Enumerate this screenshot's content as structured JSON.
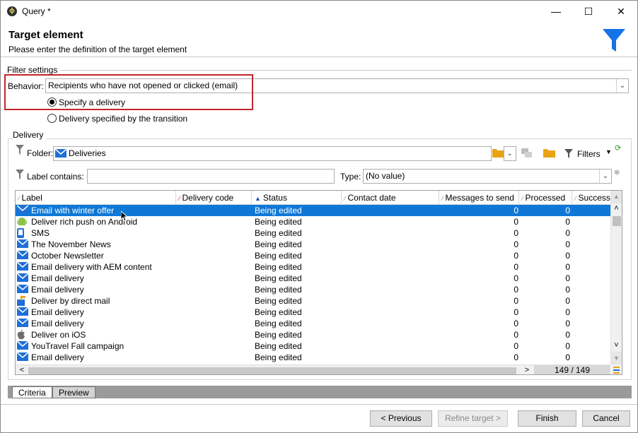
{
  "window": {
    "title": "Query *",
    "app_icon": "adobe-campaign-icon",
    "controls": {
      "minimize": "—",
      "maximize": "☐",
      "close": "✕"
    }
  },
  "header": {
    "title": "Target element",
    "subtitle": "Please enter the definition of the target element",
    "icon": "funnel-icon",
    "accent_color": "#1473e6"
  },
  "filter_settings": {
    "section_label": "Filter settings",
    "behavior_label": "Behavior:",
    "behavior_value": "Recipients who have not opened or clicked (email)",
    "radio_options": [
      {
        "label": "Specify a delivery",
        "checked": true
      },
      {
        "label": "Delivery specified by the transition",
        "checked": false
      }
    ]
  },
  "delivery": {
    "section_label": "Delivery",
    "folder_label": "Folder:",
    "folder_value": "Deliveries",
    "filters_label": "Filters",
    "label_contains_label": "Label contains:",
    "label_contains_value": "",
    "type_label": "Type:",
    "type_value": "(No value)"
  },
  "table": {
    "columns": [
      "Label",
      "Delivery code",
      "Status",
      "Contact date",
      "Messages to send",
      "Processed",
      "Success"
    ],
    "rows": [
      {
        "icon": "email",
        "label": "Email with winter offer",
        "code": "",
        "status": "Being edited",
        "contact": "",
        "to_send": "0",
        "processed": "0"
      },
      {
        "icon": "android",
        "label": "Deliver rich push on Android",
        "code": "",
        "status": "Being edited",
        "contact": "",
        "to_send": "0",
        "processed": "0"
      },
      {
        "icon": "sms",
        "label": "SMS",
        "code": "",
        "status": "Being edited",
        "contact": "",
        "to_send": "0",
        "processed": "0"
      },
      {
        "icon": "email",
        "label": "The November News",
        "code": "",
        "status": "Being edited",
        "contact": "",
        "to_send": "0",
        "processed": "0"
      },
      {
        "icon": "email",
        "label": "October Newsletter",
        "code": "",
        "status": "Being edited",
        "contact": "",
        "to_send": "0",
        "processed": "0"
      },
      {
        "icon": "email",
        "label": "Email delivery with AEM content",
        "code": "",
        "status": "Being edited",
        "contact": "",
        "to_send": "0",
        "processed": "0"
      },
      {
        "icon": "email",
        "label": "Email delivery",
        "code": "",
        "status": "Being edited",
        "contact": "",
        "to_send": "0",
        "processed": "0"
      },
      {
        "icon": "email",
        "label": "Email delivery",
        "code": "",
        "status": "Being edited",
        "contact": "",
        "to_send": "0",
        "processed": "0"
      },
      {
        "icon": "direct-mail",
        "label": "Deliver by direct mail",
        "code": "",
        "status": "Being edited",
        "contact": "",
        "to_send": "0",
        "processed": "0"
      },
      {
        "icon": "email",
        "label": "Email delivery",
        "code": "",
        "status": "Being edited",
        "contact": "",
        "to_send": "0",
        "processed": "0"
      },
      {
        "icon": "email",
        "label": "Email delivery",
        "code": "",
        "status": "Being edited",
        "contact": "",
        "to_send": "0",
        "processed": "0"
      },
      {
        "icon": "ios",
        "label": "Deliver on iOS",
        "code": "",
        "status": "Being edited",
        "contact": "",
        "to_send": "0",
        "processed": "0"
      },
      {
        "icon": "email",
        "label": "YouTravel Fall campaign",
        "code": "",
        "status": "Being edited",
        "contact": "",
        "to_send": "0",
        "processed": "0"
      },
      {
        "icon": "email",
        "label": "Email delivery",
        "code": "",
        "status": "Being edited",
        "contact": "",
        "to_send": "0",
        "processed": "0"
      }
    ],
    "selected_row": 0,
    "counter": "149 / 149"
  },
  "tabs": [
    {
      "label": "Criteria",
      "active": true
    },
    {
      "label": "Preview",
      "active": false
    }
  ],
  "buttons": {
    "previous": "< Previous",
    "refine": "Refine target >",
    "finish": "Finish",
    "cancel": "Cancel"
  }
}
